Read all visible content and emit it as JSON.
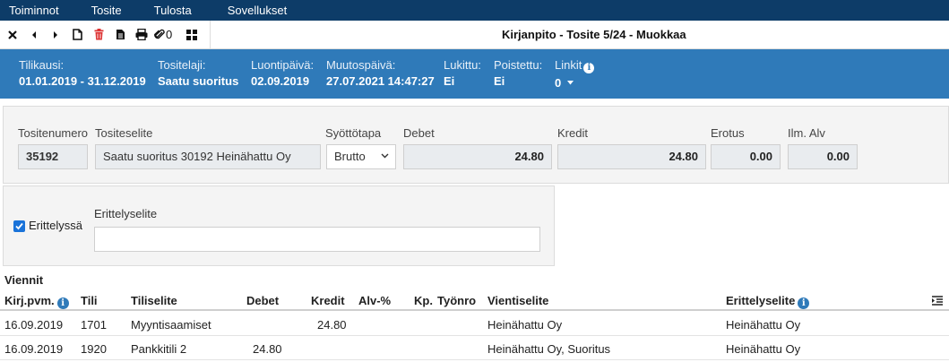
{
  "menu": [
    "Toiminnot",
    "Tosite",
    "Tulosta",
    "Sovellukset"
  ],
  "toolbar": {
    "attachments_count": "0",
    "title": "Kirjanpito - Tosite 5/24 - Muokkaa"
  },
  "info": {
    "tilikausi_label": "Tilikausi:",
    "tilikausi": "01.01.2019 - 31.12.2019",
    "tositelaji_label": "Tositelaji:",
    "tositelaji": "Saatu suoritus",
    "luontipaiva_label": "Luontipäivä:",
    "luontipaiva": "02.09.2019",
    "muutospaiva_label": "Muutospäivä:",
    "muutospaiva": "27.07.2021 14:47:27",
    "lukittu_label": "Lukittu:",
    "lukittu": "Ei",
    "poistettu_label": "Poistettu:",
    "poistettu": "Ei",
    "linkit_label": "Linkit",
    "linkit": "0"
  },
  "form": {
    "tositenumero_label": "Tositenumero",
    "tositenumero": "35192",
    "tositeselite_label": "Tositeselite",
    "tositeselite": "Saatu suoritus 30192 Heinähattu Oy",
    "syottotapa_label": "Syöttötapa",
    "syottotapa": "Brutto",
    "debet_label": "Debet",
    "debet": "24.80",
    "kredit_label": "Kredit",
    "kredit": "24.80",
    "erotus_label": "Erotus",
    "erotus": "0.00",
    "ilmalv_label": "Ilm. Alv",
    "ilmalv": "0.00"
  },
  "erittely": {
    "checkbox_label": "Erittelyssä",
    "checked": true,
    "selite_label": "Erittelyselite",
    "selite_value": ""
  },
  "viennit": {
    "title": "Viennit",
    "headers": {
      "pvm": "Kirj.pvm.",
      "tili": "Tili",
      "tiliselite": "Tiliselite",
      "debet": "Debet",
      "kredit": "Kredit",
      "alv": "Alv-%",
      "kp": "Kp.",
      "tyonro": "Työnro",
      "vientiselite": "Vientiselite",
      "erittelyselite": "Erittelyselite"
    },
    "rows": [
      {
        "pvm": "16.09.2019",
        "tili": "1701",
        "tiliselite": "Myyntisaamiset",
        "debet": "",
        "kredit": "24.80",
        "alv": "",
        "kp": "",
        "tyonro": "",
        "vientiselite": "Heinähattu Oy",
        "erittelyselite": "Heinähattu Oy"
      },
      {
        "pvm": "16.09.2019",
        "tili": "1920",
        "tiliselite": "Pankkitili 2",
        "debet": "24.80",
        "kredit": "",
        "alv": "",
        "kp": "",
        "tyonro": "",
        "vientiselite": "Heinähattu Oy, Suoritus",
        "erittelyselite": "Heinähattu Oy"
      }
    ]
  },
  "colors": {
    "menubar": "#0d3c68",
    "infoband": "#2f7ab9",
    "accent": "#1a73d9",
    "delete": "#dd3333"
  },
  "icons": [
    "close-icon",
    "prev-icon",
    "next-icon",
    "new-document-icon",
    "trash-icon",
    "copy-document-icon",
    "print-icon",
    "paperclip-icon",
    "grid-icon",
    "info-icon",
    "chevron-down-icon",
    "check-icon",
    "columns-icon"
  ]
}
